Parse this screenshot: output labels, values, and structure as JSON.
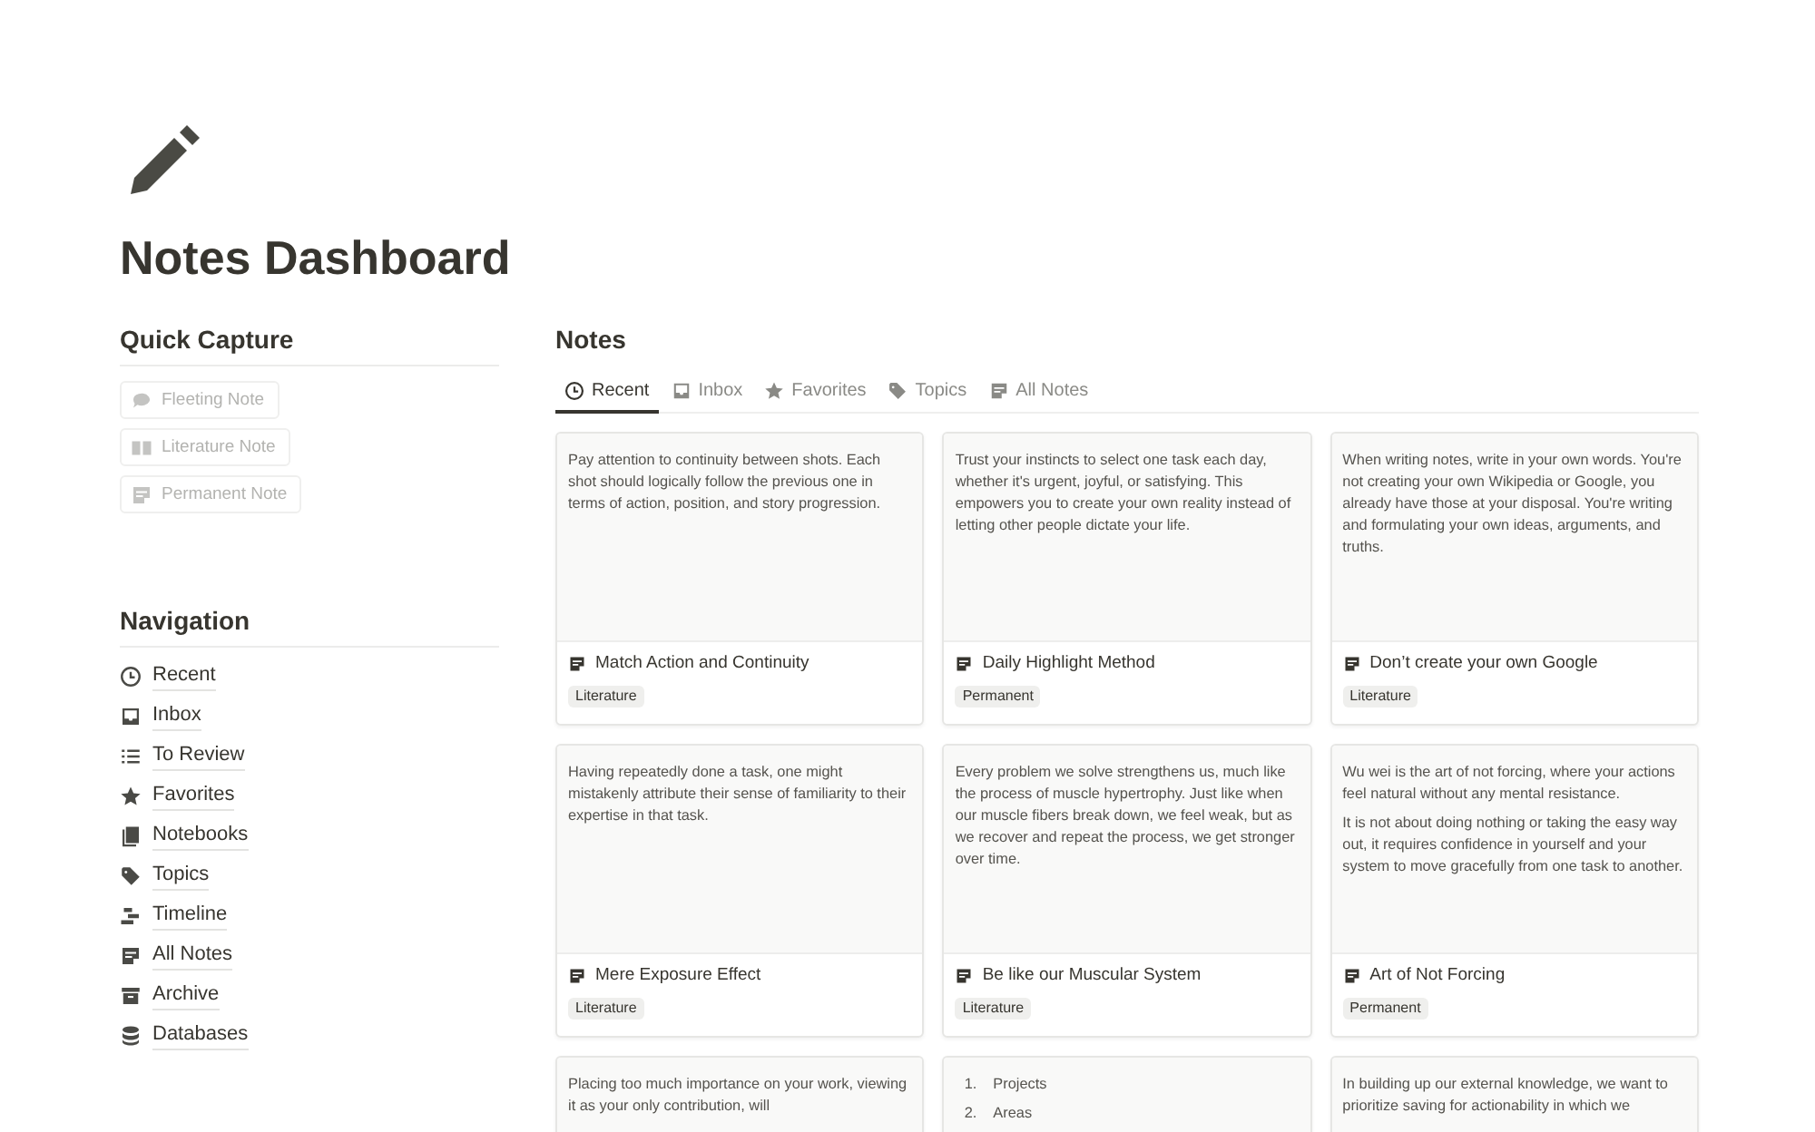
{
  "page": {
    "title": "Notes Dashboard"
  },
  "quick_capture": {
    "heading": "Quick Capture",
    "buttons": [
      "Fleeting Note",
      "Literature Note",
      "Permanent Note"
    ]
  },
  "navigation": {
    "heading": "Navigation",
    "items": [
      "Recent",
      "Inbox",
      "To Review",
      "Favorites",
      "Notebooks",
      "Topics",
      "Timeline",
      "All Notes",
      "Archive",
      "Databases"
    ]
  },
  "notes": {
    "heading": "Notes",
    "tabs": [
      {
        "label": "Recent",
        "selected": true
      },
      {
        "label": "Inbox",
        "selected": false
      },
      {
        "label": "Favorites",
        "selected": false
      },
      {
        "label": "Topics",
        "selected": false
      },
      {
        "label": "All Notes",
        "selected": false
      }
    ],
    "cards": [
      {
        "kind": "text",
        "paragraphs": [
          "Pay attention to continuity between shots. Each shot should logically follow the previous one in terms of action, position, and story progression."
        ],
        "title": "Match Action and Continuity",
        "tag": "Literature"
      },
      {
        "kind": "text",
        "paragraphs": [
          "Trust your instincts to select one task each day, whether it's urgent, joyful, or satisfying. This empowers you to create your own reality instead of letting other people dictate your life."
        ],
        "title": "Daily Highlight Method",
        "tag": "Permanent"
      },
      {
        "kind": "text",
        "paragraphs": [
          "When writing notes, write in your own words. You're not creating your own Wikipedia or Google, you already have those at your disposal. You're writing and formulating your own ideas, arguments, and truths."
        ],
        "title": "Don’t create your own Google",
        "tag": "Literature"
      },
      {
        "kind": "text",
        "paragraphs": [
          "Having repeatedly done a task, one might mistakenly attribute their sense of familiarity to their expertise in that task."
        ],
        "title": "Mere Exposure Effect",
        "tag": "Literature"
      },
      {
        "kind": "text",
        "paragraphs": [
          "Every problem we solve strengthens us, much like the process of muscle hypertrophy. Just like when our muscle fibers break down, we feel weak, but as we recover and repeat the process, we get stronger over time."
        ],
        "title": "Be like our Muscular System",
        "tag": "Literature"
      },
      {
        "kind": "text",
        "paragraphs": [
          "Wu wei is the art of not forcing, where your actions feel natural without any mental resistance.",
          "It is not about doing nothing or taking the easy way out, it requires confidence in yourself and your system to move gracefully from one task to another."
        ],
        "title": "Art of Not Forcing",
        "tag": "Permanent"
      },
      {
        "kind": "text",
        "paragraphs": [
          "Placing too much importance on your work, viewing it as your only contribution, will"
        ]
      },
      {
        "kind": "list",
        "items": [
          {
            "marker": "1.",
            "text": "Projects"
          },
          {
            "marker": "2.",
            "text": "Areas"
          }
        ]
      },
      {
        "kind": "text",
        "paragraphs": [
          "In building up our external knowledge, we want to prioritize saving for actionability in which we"
        ]
      }
    ]
  }
}
